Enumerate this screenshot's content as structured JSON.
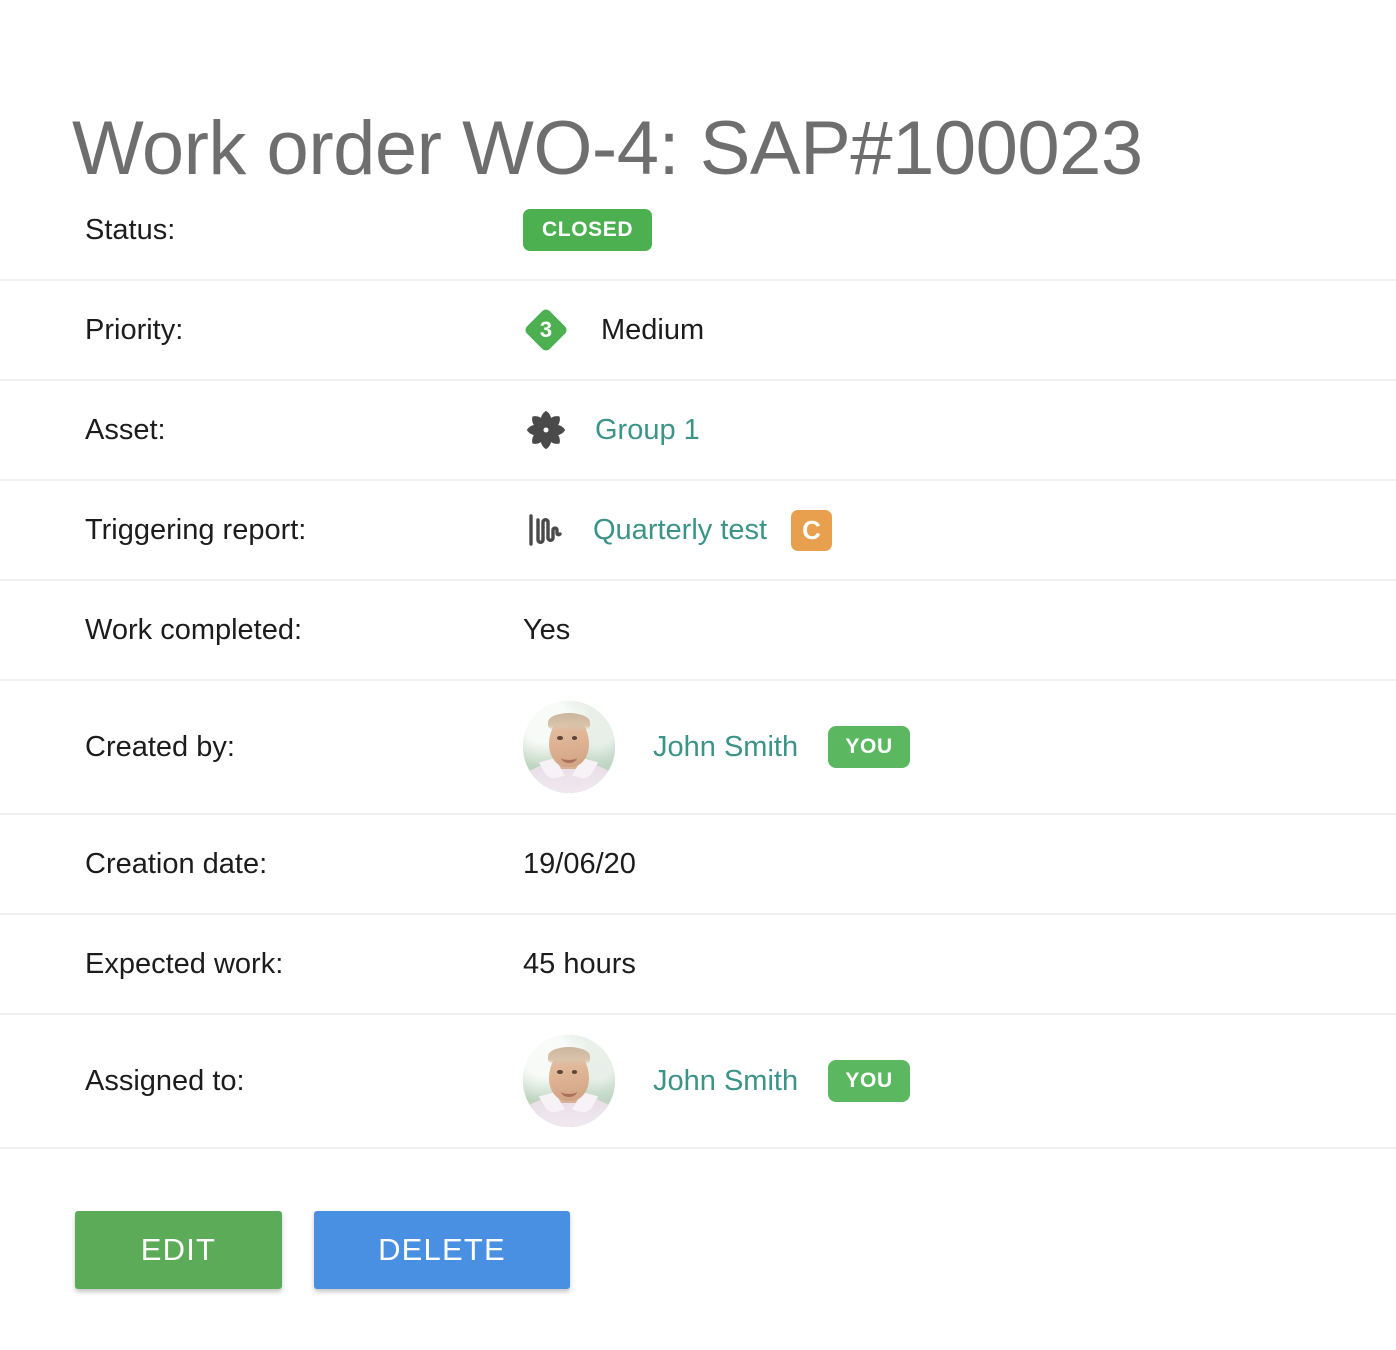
{
  "page": {
    "title": "Work order WO-4: SAP#100023"
  },
  "colors": {
    "title_gray": "#6e6e6e",
    "status_green": "#4caf50",
    "you_green": "#5cb860",
    "link_teal": "#3c9488",
    "letter_badge_orange": "#e8a04e",
    "edit_green": "#5cab58",
    "delete_blue": "#4a90e2",
    "divider_gray": "#f0f0f0",
    "icon_gray": "#4a4a4a"
  },
  "rows": [
    {
      "label": "Status:",
      "kind": "status-badge",
      "badge": "Closed"
    },
    {
      "label": "Priority:",
      "kind": "priority",
      "priority_number": "3",
      "value": "Medium",
      "icon": "priority-diamond-icon"
    },
    {
      "label": "Asset:",
      "kind": "link",
      "value": "Group 1",
      "icon": "asset-pinwheel-icon"
    },
    {
      "label": "Triggering report:",
      "kind": "link-badge",
      "value": "Quarterly test",
      "icon": "report-waveform-icon",
      "letter_badge": "C"
    },
    {
      "label": "Work completed:",
      "kind": "text",
      "value": "Yes"
    },
    {
      "label": "Created by:",
      "kind": "person",
      "value": "John Smith",
      "you_badge": "You"
    },
    {
      "label": "Creation date:",
      "kind": "text",
      "value": "19/06/20"
    },
    {
      "label": "Expected work:",
      "kind": "text",
      "value": "45 hours"
    },
    {
      "label": "Assigned to:",
      "kind": "person",
      "value": "John Smith",
      "you_badge": "You"
    }
  ],
  "actions": {
    "edit_label": "Edit",
    "delete_label": "Delete"
  }
}
